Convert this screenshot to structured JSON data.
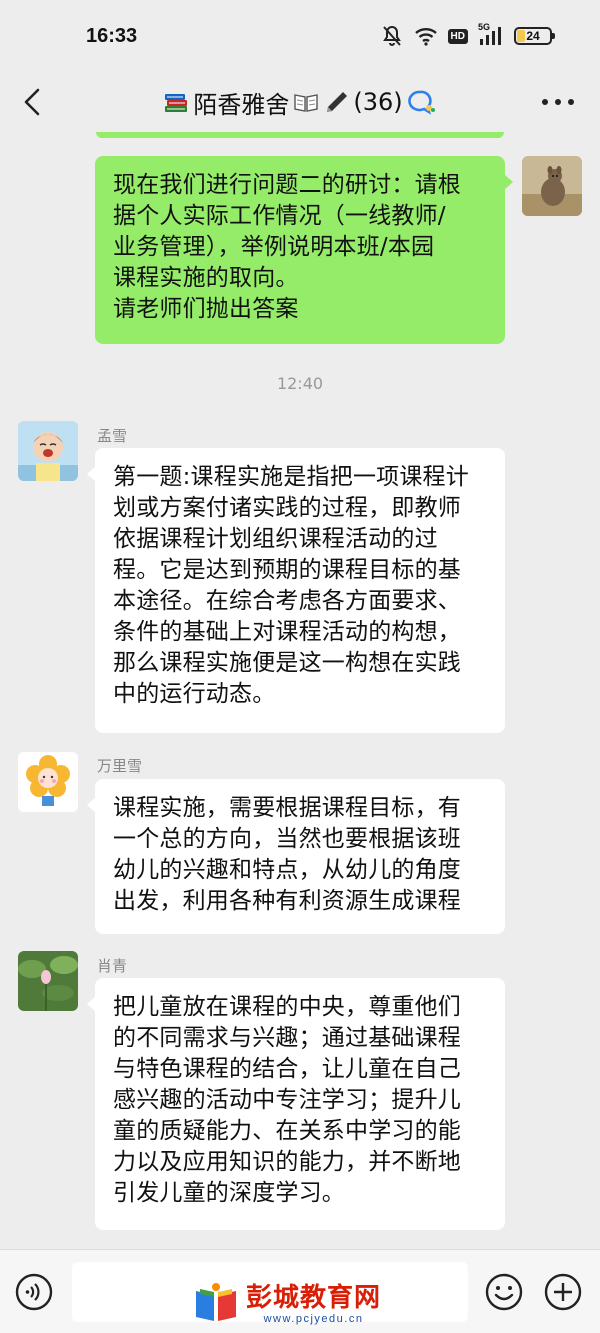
{
  "status_bar": {
    "time": "16:33",
    "icons": [
      "mute-bell-icon",
      "wifi-icon",
      "hd-icon",
      "5g-signal-icon",
      "battery-icon"
    ],
    "hd_label": "HD",
    "network_label": "5G",
    "battery_level": "24"
  },
  "header": {
    "title": "陌香雅舍",
    "member_count": "(36)",
    "icons": [
      "back-arrow-icon",
      "books-emoji-icon",
      "open-book-emoji-icon",
      "pen-emoji-icon",
      "chat-bubble-icon",
      "more-icon"
    ]
  },
  "messages": [
    {
      "type": "self",
      "lines": [
        "现在我们进行问题二的研讨：请根",
        "据个人实际工作情况（一线教师/",
        "业务管理），举例说明本班/本园",
        "课程实施的取向。",
        "请老师们抛出答案"
      ]
    },
    {
      "type": "time",
      "text": "12:40"
    },
    {
      "type": "other",
      "sender": "孟雪",
      "lines": [
        "第一题:课程实施是指把一项课程计",
        "划或方案付诸实践的过程，即教师",
        "依据课程计划组织课程活动的过",
        "程。它是达到预期的课程目标的基",
        "本途径。在综合考虑各方面要求、",
        "条件的基础上对课程活动的构想，",
        "那么课程实施便是这一构想在实践",
        "中的运行动态。"
      ]
    },
    {
      "type": "other",
      "sender": "万里雪",
      "lines": [
        "课程实施，需要根据课程目标，有",
        "一个总的方向，当然也要根据该班",
        "幼儿的兴趣和特点，从幼儿的角度",
        "出发，利用各种有利资源生成课程"
      ]
    },
    {
      "type": "other",
      "sender": "肖青",
      "lines": [
        "把儿童放在课程的中央，尊重他们",
        "的不同需求与兴趣；通过基础课程",
        "与特色课程的结合，让儿童在自己",
        "感兴趣的活动中专注学习；提升儿",
        "童的质疑能力、在关系中学习的能",
        "力以及应用知识的能力，并不断地",
        "引发儿童的深度学习。"
      ]
    }
  ],
  "bottom_bar": {
    "icons": [
      "voice-icon",
      "emoji-icon",
      "plus-icon"
    ]
  },
  "watermark": {
    "name": "彭城教育网",
    "url": "www.pcjyedu.cn"
  },
  "colors": {
    "background": "#ededed",
    "self_bubble": "#95ec69",
    "other_bubble": "#ffffff",
    "watermark_red": "#d81e06",
    "watermark_blue": "#1a4fa0"
  }
}
